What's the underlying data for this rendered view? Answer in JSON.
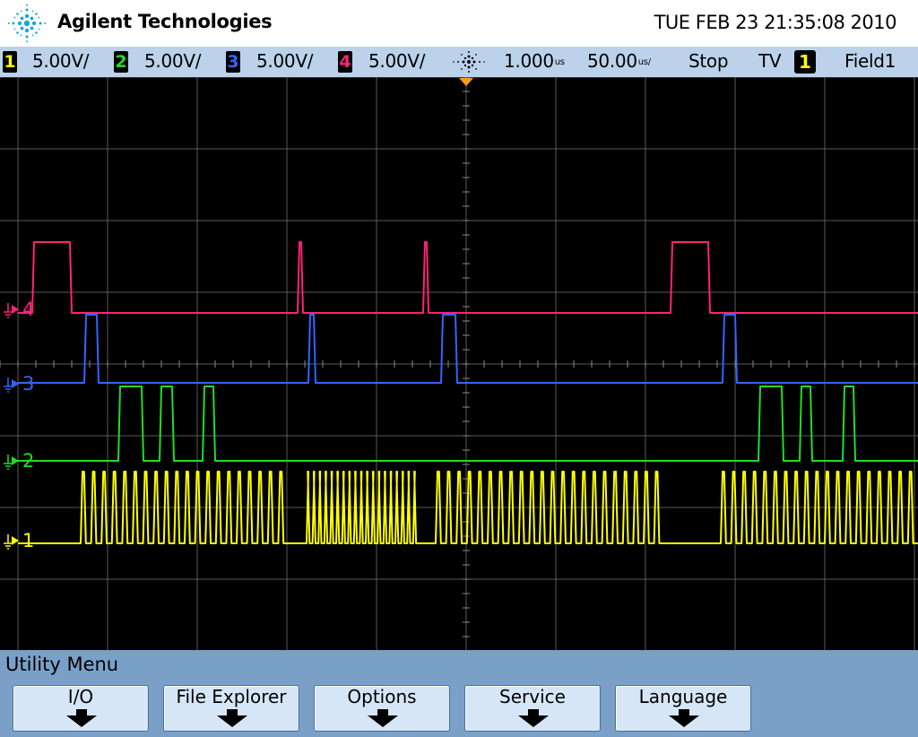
{
  "header": {
    "brand": "Agilent Technologies",
    "datetime": "TUE FEB 23 21:35:08 2010"
  },
  "status": {
    "channels": [
      {
        "num": "1",
        "scale": "5.00V/",
        "color": "#ffff00"
      },
      {
        "num": "2",
        "scale": "5.00V/",
        "color": "#22dd22"
      },
      {
        "num": "3",
        "scale": "5.00V/",
        "color": "#3366ff"
      },
      {
        "num": "4",
        "scale": "5.00V/",
        "color": "#ff2277"
      }
    ],
    "delay": "1.000",
    "delay_unit": "us",
    "timebase": "50.00",
    "timebase_unit": "us/",
    "run_state": "Stop",
    "trigger_mode": "TV",
    "trigger_source": "1",
    "trigger_field": "Field1"
  },
  "screen": {
    "ground_markers": [
      {
        "num": "4",
        "color": "#ff2277"
      },
      {
        "num": "3",
        "color": "#3366ff"
      },
      {
        "num": "2",
        "color": "#22dd22"
      },
      {
        "num": "1",
        "color": "#ffff00"
      }
    ],
    "grid_color": "#5a5a5a",
    "trigger_marker_color": "#ff9a1a"
  },
  "menu": {
    "title": "Utility Menu",
    "softkeys": [
      {
        "label": "I/O"
      },
      {
        "label": "File Explorer"
      },
      {
        "label": "Options"
      },
      {
        "label": "Service"
      },
      {
        "label": "Language"
      }
    ]
  }
}
